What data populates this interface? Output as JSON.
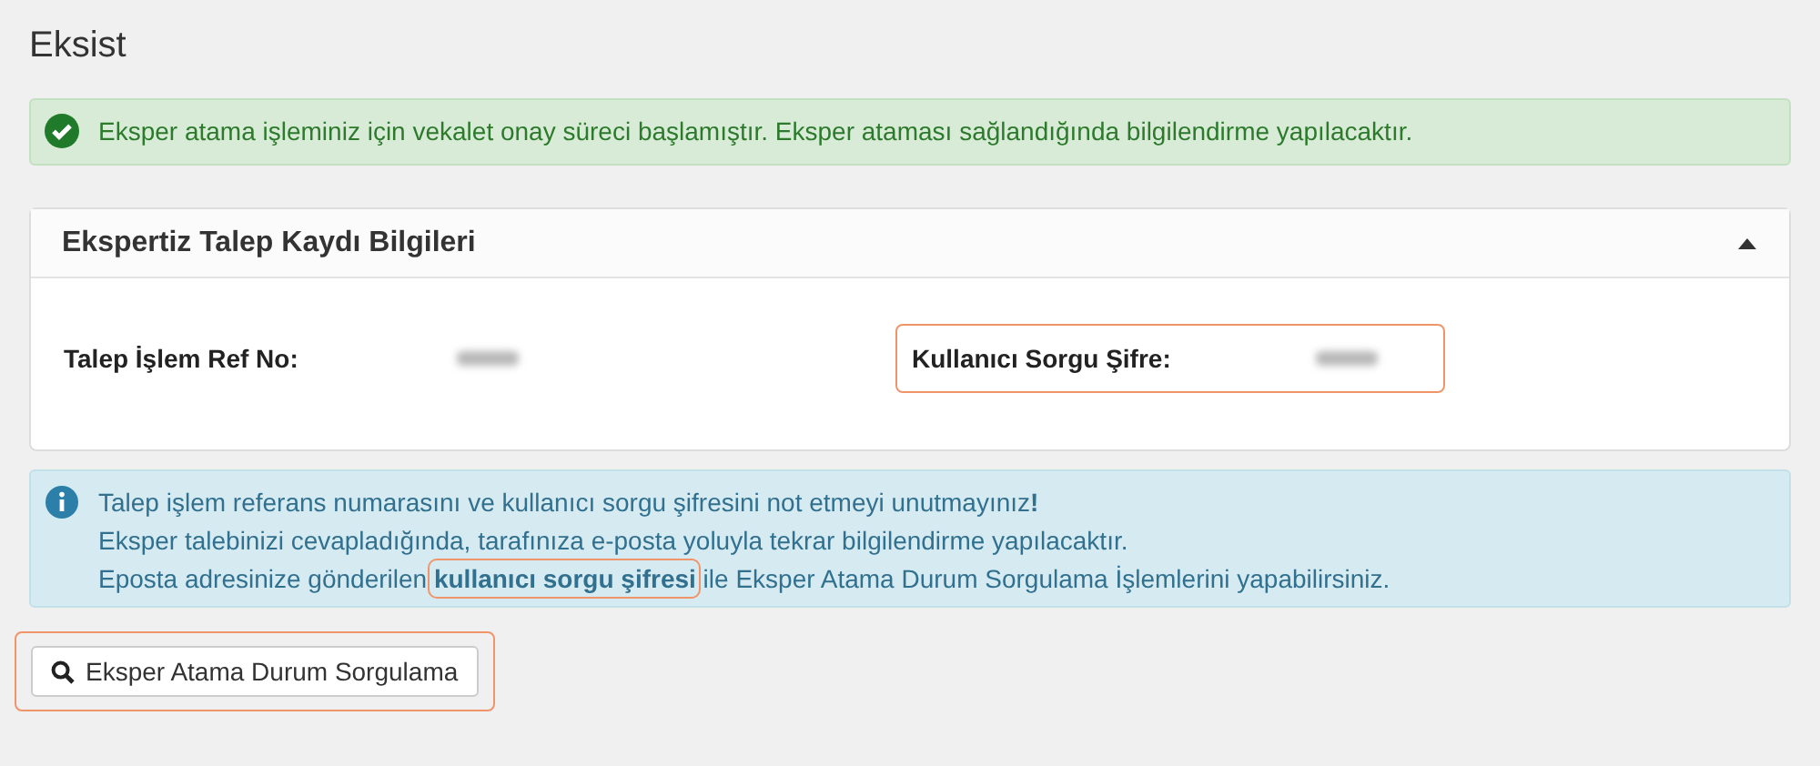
{
  "page_title": "Eksist",
  "success_alert": {
    "text": "Eksper atama işleminiz için vekalet onay süreci başlamıştır. Eksper ataması sağlandığında bilgilendirme yapılacaktır."
  },
  "panel": {
    "title": "Ekspertiz Talep Kaydı Bilgileri",
    "expanded": true,
    "fields": [
      {
        "label": "Talep İşlem Ref No:",
        "value_blurred": true,
        "highlighted": false
      },
      {
        "label": "Kullanıcı Sorgu Şifre:",
        "value_blurred": true,
        "highlighted": true
      }
    ]
  },
  "info_alert": {
    "lines": [
      {
        "text": "Talep işlem referans numarasını ve kullanıcı sorgu şifresini not etmeyi unutmayınız**!**"
      },
      {
        "text": "Eksper talebinizi cevapladığında, tarafınıza e-posta yoluyla tekrar bilgilendirme yapılacaktır."
      },
      {
        "text": "Eposta adresinize gönderilen **kullanıcı sorgu şifresi** ile Eksper Atama Durum Sorgulama İşlemlerini yapabilirsiniz.",
        "highlighted": true
      }
    ]
  },
  "query_button": {
    "label": "Eksper Atama Durum Sorgulama",
    "highlighted": true
  }
}
